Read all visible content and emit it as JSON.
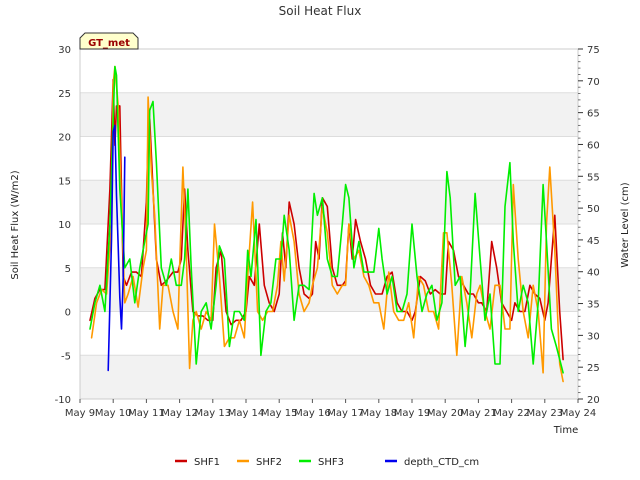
{
  "chart_data": {
    "type": "line",
    "title": "Soil Heat Flux",
    "badge": "GT_met",
    "xlabel": "Time",
    "ylabel_left": "Soil Heat Flux (W/m2)",
    "ylabel_right": "Water Level (cm)",
    "xlim": [
      9,
      24
    ],
    "ylim_left": [
      -10,
      30
    ],
    "ylim_right": [
      20,
      75
    ],
    "x_ticks": [
      {
        "x": 9,
        "label": "May 9"
      },
      {
        "x": 10,
        "label": "May 10"
      },
      {
        "x": 11,
        "label": "May 11"
      },
      {
        "x": 12,
        "label": "May 12"
      },
      {
        "x": 13,
        "label": "May 13"
      },
      {
        "x": 14,
        "label": "May 14"
      },
      {
        "x": 15,
        "label": "May 15"
      },
      {
        "x": 16,
        "label": "May 16"
      },
      {
        "x": 17,
        "label": "May 17"
      },
      {
        "x": 18,
        "label": "May 18"
      },
      {
        "x": 19,
        "label": "May 19"
      },
      {
        "x": 20,
        "label": "May 20"
      },
      {
        "x": 21,
        "label": "May 21"
      },
      {
        "x": 22,
        "label": "May 22"
      },
      {
        "x": 23,
        "label": "May 23"
      },
      {
        "x": 24,
        "label": "May 24"
      }
    ],
    "y_ticks_left": [
      -10,
      -5,
      0,
      5,
      10,
      15,
      20,
      25,
      30
    ],
    "y_ticks_right": [
      20,
      25,
      30,
      35,
      40,
      45,
      50,
      55,
      60,
      65,
      70,
      75
    ],
    "grid": true,
    "legend_position": "bottom-center",
    "series": [
      {
        "name": "SHF1",
        "color": "#cc0000",
        "axis": "left",
        "x": [
          9.3,
          9.45,
          9.6,
          9.75,
          9.9,
          10.0,
          10.05,
          10.1,
          10.2,
          10.3,
          10.4,
          10.55,
          10.7,
          10.85,
          11.0,
          11.05,
          11.1,
          11.2,
          11.3,
          11.45,
          11.6,
          11.8,
          11.95,
          12.05,
          12.15,
          12.25,
          12.4,
          12.55,
          12.7,
          12.85,
          13.0,
          13.1,
          13.25,
          13.4,
          13.55,
          13.7,
          13.85,
          14.0,
          14.1,
          14.25,
          14.4,
          14.55,
          14.7,
          14.85,
          15.0,
          15.1,
          15.2,
          15.3,
          15.45,
          15.6,
          15.75,
          15.9,
          16.0,
          16.1,
          16.2,
          16.3,
          16.45,
          16.6,
          16.75,
          16.9,
          17.0,
          17.1,
          17.2,
          17.3,
          17.45,
          17.6,
          17.75,
          17.9,
          18.0,
          18.1,
          18.25,
          18.4,
          18.55,
          18.7,
          18.85,
          19.0,
          19.1,
          19.25,
          19.4,
          19.55,
          19.7,
          19.85,
          20.0,
          20.1,
          20.25,
          20.4,
          20.55,
          20.7,
          20.85,
          21.0,
          21.1,
          21.25,
          21.4,
          21.55,
          21.7,
          21.85,
          22.0,
          22.1,
          22.25,
          22.4,
          22.55,
          22.7,
          22.85,
          23.0,
          23.1,
          23.2,
          23.3,
          23.45,
          23.55
        ],
        "y": [
          -1,
          1.5,
          2.5,
          2.5,
          14,
          26.5,
          19,
          23.5,
          23.5,
          4,
          3,
          4.5,
          4.5,
          4,
          12.5,
          20,
          22,
          14,
          6,
          3,
          3.5,
          4.5,
          4.5,
          6,
          14,
          7,
          0,
          -0.5,
          -0.5,
          -1,
          -1,
          5,
          7,
          0,
          -1.5,
          -1,
          -1,
          0,
          4,
          3,
          10,
          3,
          1,
          0,
          2,
          9,
          5,
          12.5,
          10,
          5,
          2,
          1.5,
          2,
          8,
          6,
          13,
          12,
          5,
          3,
          3,
          3.5,
          10,
          6,
          10.5,
          8,
          6,
          3,
          2,
          2,
          2,
          4,
          4.5,
          1,
          0,
          0,
          -1,
          0,
          4,
          3.5,
          2,
          2.5,
          2,
          2,
          8,
          7,
          4,
          3,
          2,
          2,
          1,
          1,
          0,
          8,
          5,
          1,
          0,
          -1,
          1,
          0,
          0,
          3,
          2,
          1.5,
          -1,
          1,
          6,
          11,
          0,
          -5.5
        ]
      },
      {
        "name": "SHF2",
        "color": "#ff9900",
        "axis": "left",
        "x": [
          9.35,
          9.5,
          9.65,
          9.8,
          9.95,
          10.0,
          10.05,
          10.15,
          10.25,
          10.35,
          10.45,
          10.6,
          10.75,
          10.9,
          11.0,
          11.05,
          11.15,
          11.25,
          11.4,
          11.5,
          11.65,
          11.8,
          11.95,
          12.0,
          12.1,
          12.2,
          12.3,
          12.4,
          12.5,
          12.65,
          12.8,
          12.95,
          13.05,
          13.2,
          13.35,
          13.5,
          13.65,
          13.8,
          13.95,
          14.05,
          14.2,
          14.35,
          14.5,
          14.65,
          14.8,
          14.95,
          15.05,
          15.15,
          15.3,
          15.45,
          15.6,
          15.75,
          15.9,
          16.0,
          16.15,
          16.3,
          16.45,
          16.6,
          16.75,
          16.9,
          17.0,
          17.1,
          17.25,
          17.4,
          17.55,
          17.7,
          17.85,
          18.0,
          18.15,
          18.3,
          18.45,
          18.6,
          18.75,
          18.9,
          19.05,
          19.2,
          19.35,
          19.5,
          19.65,
          19.8,
          19.95,
          20.05,
          20.2,
          20.35,
          20.5,
          20.65,
          20.8,
          20.95,
          21.05,
          21.2,
          21.35,
          21.5,
          21.65,
          21.8,
          21.95,
          22.05,
          22.2,
          22.35,
          22.5,
          22.65,
          22.8,
          22.95,
          23.05,
          23.15,
          23.3,
          23.45,
          23.55
        ],
        "y": [
          -3,
          1,
          2.5,
          2,
          10,
          26,
          28,
          23.5,
          12,
          1,
          2,
          4,
          0.5,
          5,
          7,
          24.5,
          16,
          11,
          -2,
          3,
          3,
          0,
          -2,
          5,
          16.5,
          7,
          -6.5,
          -1,
          0,
          -2,
          0,
          -1,
          10,
          4,
          -4,
          -3,
          -3,
          -1,
          -3,
          4,
          12.5,
          0,
          -1,
          0,
          0,
          3,
          8,
          3.5,
          11,
          8,
          2,
          0,
          1,
          3,
          5,
          12,
          9,
          3,
          2,
          3,
          3,
          10,
          6,
          7,
          4,
          3,
          1,
          1,
          -2,
          4.5,
          0,
          -1,
          -1,
          1,
          -3,
          4,
          3,
          0,
          0,
          -2,
          9,
          9,
          3,
          -5,
          4,
          1,
          -3,
          2,
          3,
          0,
          -2,
          3,
          3,
          -2,
          -2,
          14.5,
          6,
          0,
          -3,
          3,
          0,
          -7,
          10,
          16.5,
          7,
          -6,
          -8
        ]
      },
      {
        "name": "SHF3",
        "color": "#00ee00",
        "axis": "left",
        "x": [
          9.3,
          9.45,
          9.6,
          9.75,
          9.9,
          10.0,
          10.05,
          10.1,
          10.2,
          10.35,
          10.5,
          10.65,
          10.8,
          10.95,
          11.05,
          11.1,
          11.2,
          11.3,
          11.45,
          11.6,
          11.75,
          11.9,
          12.05,
          12.15,
          12.25,
          12.35,
          12.5,
          12.65,
          12.8,
          12.95,
          13.1,
          13.2,
          13.35,
          13.5,
          13.65,
          13.8,
          13.95,
          14.05,
          14.15,
          14.3,
          14.45,
          14.6,
          14.75,
          14.9,
          15.05,
          15.15,
          15.3,
          15.45,
          15.6,
          15.75,
          15.9,
          16.05,
          16.15,
          16.3,
          16.45,
          16.6,
          16.75,
          16.9,
          17.0,
          17.1,
          17.25,
          17.4,
          17.55,
          17.7,
          17.85,
          18.0,
          18.1,
          18.25,
          18.4,
          18.55,
          18.7,
          18.85,
          19.0,
          19.15,
          19.3,
          19.45,
          19.6,
          19.75,
          19.9,
          20.05,
          20.15,
          20.3,
          20.45,
          20.6,
          20.75,
          20.9,
          21.05,
          21.2,
          21.35,
          21.5,
          21.65,
          21.8,
          21.95,
          22.05,
          22.2,
          22.35,
          22.5,
          22.65,
          22.8,
          22.95,
          23.05,
          23.2,
          23.35,
          23.55
        ],
        "y": [
          -2,
          1,
          3,
          0,
          10,
          22,
          28,
          27,
          14,
          5,
          6,
          1,
          5,
          8,
          10,
          23,
          24,
          17,
          5,
          3,
          6,
          3,
          3,
          6,
          14,
          5,
          -6,
          0,
          1,
          -2,
          3,
          7.5,
          6,
          -4,
          0,
          0,
          -1,
          7,
          4,
          10.5,
          -5,
          0,
          1,
          6,
          6,
          11,
          7,
          -1,
          3,
          3,
          2.5,
          13.5,
          11,
          13,
          6,
          4,
          4,
          10,
          14.5,
          13,
          5,
          8,
          4.5,
          4.5,
          4.5,
          9.5,
          6,
          2,
          4,
          0,
          0,
          2,
          10,
          4,
          0,
          2,
          3,
          -1,
          1,
          16,
          13,
          3,
          4,
          -4,
          2,
          13.5,
          6,
          -1,
          2,
          -6,
          -6,
          12,
          17,
          8,
          0,
          3,
          1,
          -6,
          1,
          14.5,
          8,
          -2,
          -4,
          -7
        ]
      },
      {
        "name": "depth_CTD_cm",
        "color": "#0000ee",
        "axis": "right",
        "x": [
          9.85,
          9.9,
          9.95,
          10.0,
          10.05,
          10.1,
          10.15,
          10.2,
          10.25,
          10.3,
          10.35
        ],
        "y": [
          24.5,
          35,
          45,
          62,
          63,
          52,
          44,
          36,
          31,
          39,
          58
        ]
      }
    ]
  }
}
